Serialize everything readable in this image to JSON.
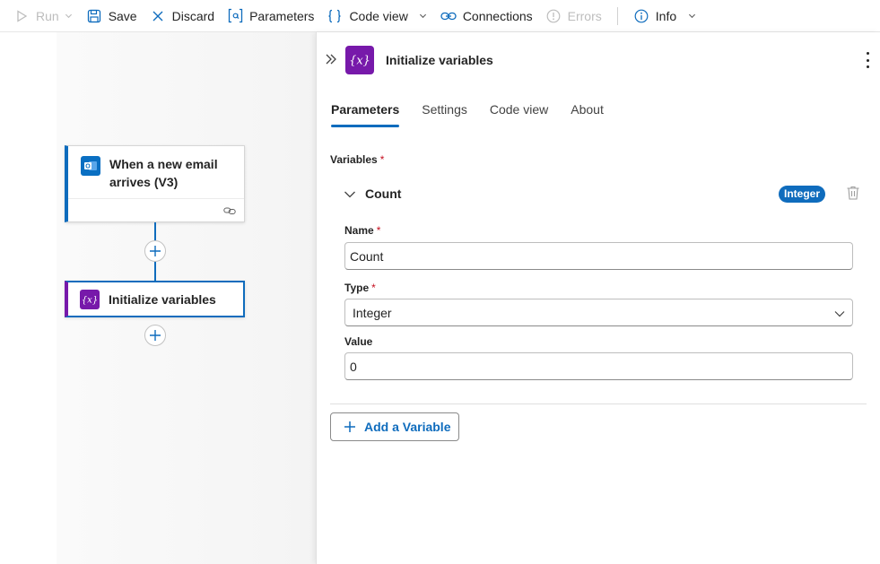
{
  "toolbar": {
    "run": "Run",
    "save": "Save",
    "discard": "Discard",
    "parameters": "Parameters",
    "code_view": "Code view",
    "connections": "Connections",
    "errors": "Errors",
    "info": "Info"
  },
  "canvas": {
    "trigger_title": "When a new email arrives (V3)",
    "action_title": "Initialize variables"
  },
  "panel": {
    "title": "Initialize variables",
    "tabs": [
      "Parameters",
      "Settings",
      "Code view",
      "About"
    ],
    "active_tab": "Parameters",
    "variables_label": "Variables",
    "required_mark": "*",
    "variable": {
      "header": "Count",
      "type_badge": "Integer",
      "name_label": "Name",
      "name_value": "Count",
      "type_label": "Type",
      "type_value": "Integer",
      "value_label": "Value",
      "value_value": "0"
    },
    "add_button": "Add a Variable"
  },
  "colors": {
    "accent": "#0f6cbd",
    "variables_purple": "#7719aa",
    "outlook_blue": "#0a6fc2",
    "required_red": "#c50f1f"
  },
  "icons": {
    "run": "play-icon",
    "save": "save-icon",
    "discard": "close-icon",
    "parameters": "parameters-icon",
    "code_view": "braces-icon",
    "connections": "link-icon",
    "errors": "error-circle-icon",
    "info": "info-icon"
  }
}
